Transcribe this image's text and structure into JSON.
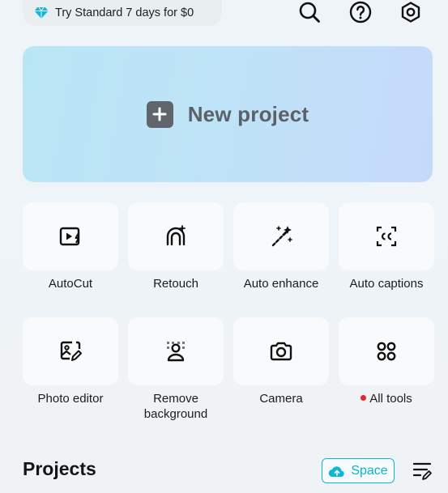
{
  "banner": {
    "trial_text": "Try Standard 7 days for $0",
    "icon": "diamond-icon",
    "icon_color": "#1bb6d6"
  },
  "header_icons": [
    "search-icon",
    "help-icon",
    "settings-icon"
  ],
  "new_project": {
    "label": "New project",
    "icon": "plus-icon"
  },
  "tools": [
    {
      "label": "AutoCut",
      "icon": "autocut-icon"
    },
    {
      "label": "Retouch",
      "icon": "retouch-icon"
    },
    {
      "label": "Auto enhance",
      "icon": "magic-wand-icon"
    },
    {
      "label": "Auto captions",
      "icon": "captions-icon"
    },
    {
      "label": "Photo editor",
      "icon": "photo-edit-icon"
    },
    {
      "label": "Remove background",
      "icon": "remove-bg-icon"
    },
    {
      "label": "Camera",
      "icon": "camera-icon"
    },
    {
      "label": "All tools",
      "icon": "grid-icon",
      "badge": "red-dot"
    }
  ],
  "projects": {
    "title": "Projects",
    "space_label": "Space",
    "space_icon": "cloud-upload-icon",
    "edit_icon": "list-edit-icon",
    "accent": "#11b6d2"
  }
}
